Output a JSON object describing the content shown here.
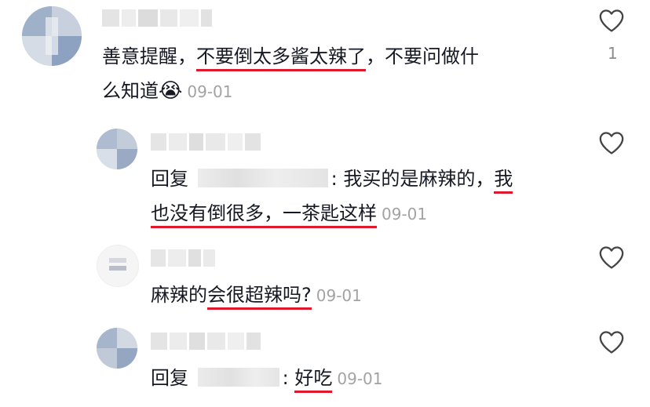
{
  "comments": [
    {
      "id": "c1",
      "line1_pre": "善意提醒，",
      "line1_underlined": "不要倒太多酱太辣了",
      "line1_post": "，不要问做什",
      "line2": "么知道",
      "emoji": "😭",
      "date": "09-01",
      "like_count": "1"
    },
    {
      "id": "r1",
      "reply_prefix": "回复",
      "colon": ":",
      "line1_text": "我买的是麻辣的，",
      "line1_underlined": "我",
      "line2_underlined": "也没有倒很多，一茶匙这样",
      "date": "09-01"
    },
    {
      "id": "r2",
      "pre": "麻辣的",
      "underlined": "会很超辣吗?",
      "date": "09-01"
    },
    {
      "id": "r3",
      "reply_prefix": "回复",
      "colon": ":",
      "underlined": "好吃",
      "date": "09-01"
    }
  ],
  "colors": {
    "underline": "#e0182b",
    "date": "#a3a3a3",
    "text": "#161823"
  },
  "icons": [
    "heart-outline-icon",
    "crying-emoji-icon"
  ]
}
